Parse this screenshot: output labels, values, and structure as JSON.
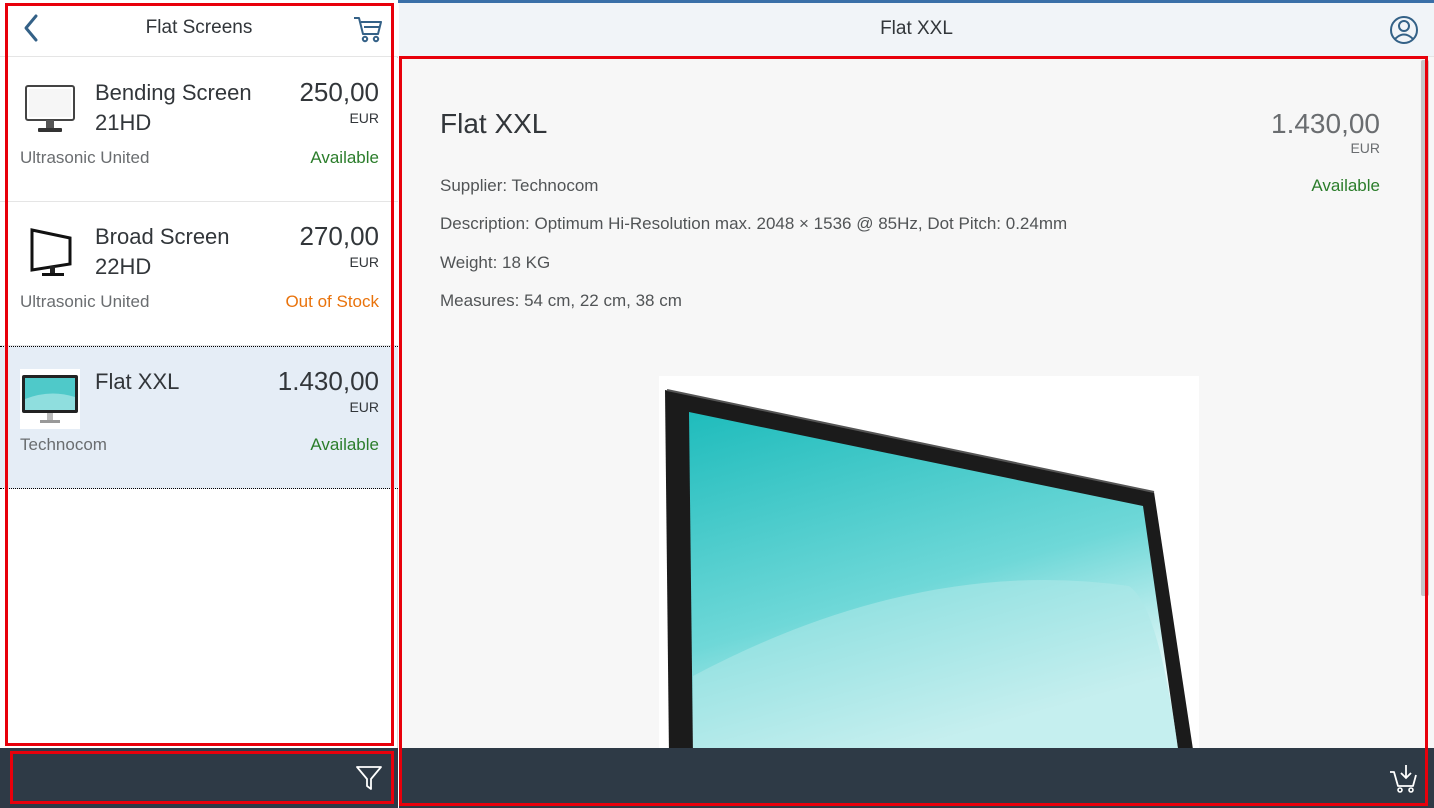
{
  "master": {
    "title": "Flat Screens",
    "items": [
      {
        "name": "Bending Screen 21HD",
        "price": "250,00",
        "currency": "EUR",
        "supplier": "Ultrasonic United",
        "status": "Available",
        "status_type": "success",
        "thumb_icon": "monitor-white-icon"
      },
      {
        "name": "Broad Screen 22HD",
        "price": "270,00",
        "currency": "EUR",
        "supplier": "Ultrasonic United",
        "status": "Out of Stock",
        "status_type": "warning",
        "thumb_icon": "monitor-black-icon"
      },
      {
        "name": "Flat XXL",
        "price": "1.430,00",
        "currency": "EUR",
        "supplier": "Technocom",
        "status": "Available",
        "status_type": "success",
        "thumb_icon": "monitor-teal-icon",
        "selected": true
      }
    ]
  },
  "detail": {
    "header_title": "Flat XXL",
    "title": "Flat XXL",
    "price": "1.430,00",
    "currency": "EUR",
    "status": "Available",
    "supplier": "Supplier: Technocom",
    "description": "Description: Optimum Hi-Resolution max. 2048 × 1536 @ 85Hz, Dot Pitch: 0.24mm",
    "weight": "Weight: 18 KG",
    "measures": "Measures: 54 cm, 22 cm, 38 cm"
  },
  "colors": {
    "success": "#2b7d2b",
    "warning": "#e9730c",
    "footer": "#2e3a46",
    "selected_bg": "#e5edf6",
    "highlight": "#e8000b"
  },
  "icons": {
    "back": "chevron-left-icon",
    "cart": "cart-icon",
    "user": "user-icon",
    "filter": "filter-icon",
    "checkout": "cart-checkout-icon"
  }
}
